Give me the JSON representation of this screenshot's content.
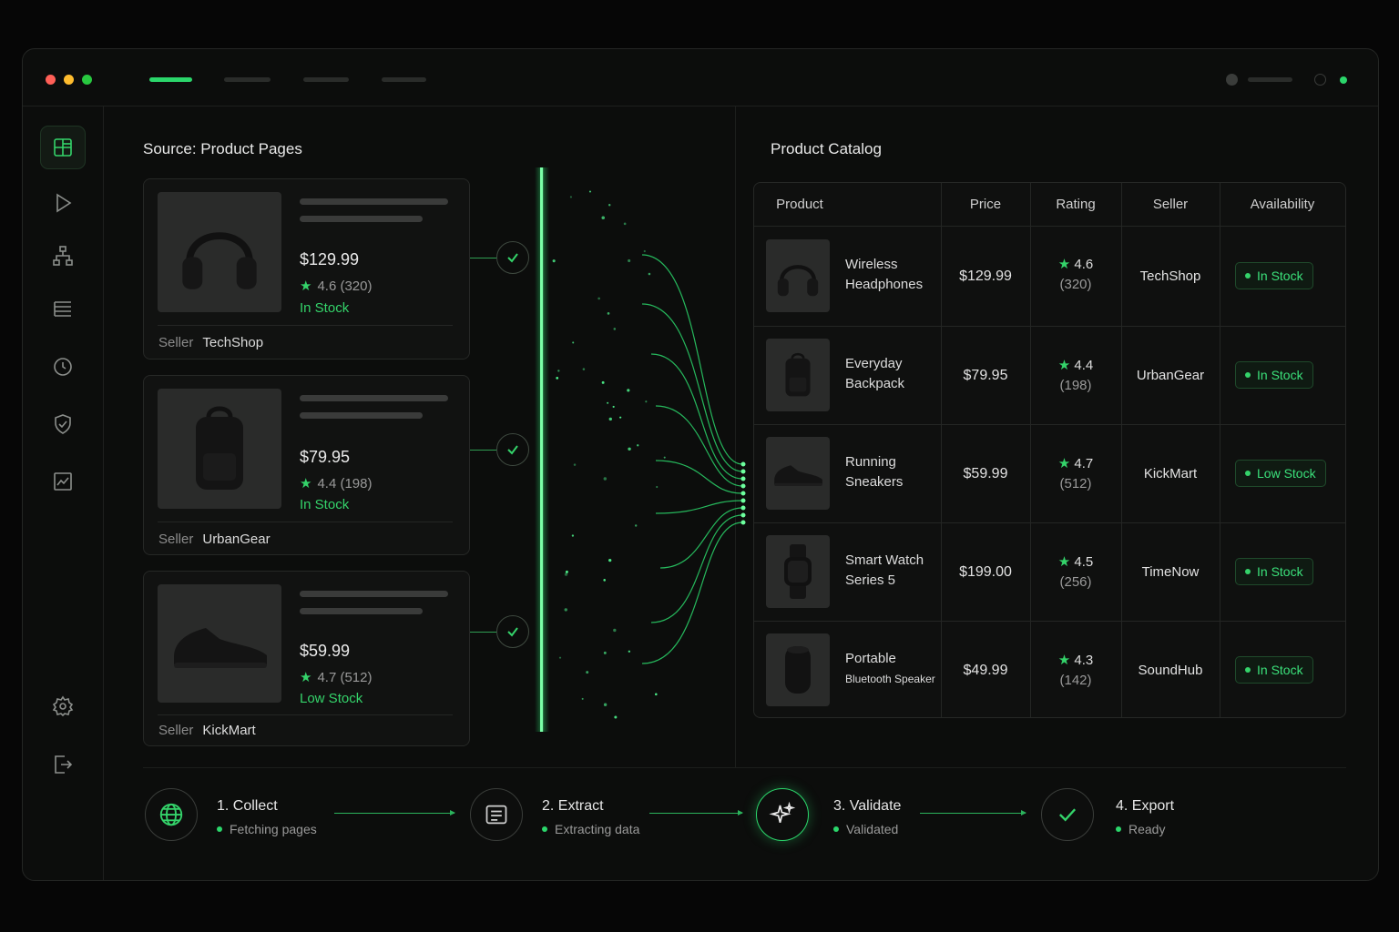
{
  "window": {
    "controls": {
      "close_color": "#ff5f57",
      "minimize_color": "#febc2e",
      "maximize_color": "#28c840"
    },
    "accent": "#2bd66b"
  },
  "sidebar": {
    "items": [
      {
        "icon": "dashboard-icon",
        "active": true
      },
      {
        "icon": "play-icon"
      },
      {
        "icon": "hierarchy-icon"
      },
      {
        "icon": "list-icon"
      },
      {
        "icon": "clock-icon"
      },
      {
        "icon": "shield-check-icon"
      },
      {
        "icon": "chart-icon"
      },
      {
        "icon": "gear-icon"
      },
      {
        "icon": "logout-icon"
      }
    ]
  },
  "source": {
    "title": "Source: Product Pages",
    "seller_label": "Seller",
    "cards": [
      {
        "price": "$129.99",
        "rating": "4.6 (320)",
        "stock": "In Stock",
        "seller": "TechShop",
        "image": "headphones-icon"
      },
      {
        "price": "$79.95",
        "rating": "4.4 (198)",
        "stock": "In Stock",
        "seller": "UrbanGear",
        "image": "backpack-icon"
      },
      {
        "price": "$59.99",
        "rating": "4.7 (512)",
        "stock": "Low Stock",
        "seller": "KickMart",
        "image": "sneaker-icon"
      }
    ]
  },
  "catalog": {
    "title": "Product Catalog",
    "columns": [
      "Product",
      "Price",
      "Rating",
      "Seller",
      "Availability"
    ],
    "rows": [
      {
        "name_line1": "Wireless",
        "name_line2": "Headphones",
        "price": "$129.99",
        "rating": "4.6",
        "count": "(320)",
        "seller": "TechShop",
        "availability": "In Stock",
        "image": "headphones-icon"
      },
      {
        "name_line1": "Everyday",
        "name_line2": "Backpack",
        "price": "$79.95",
        "rating": "4.4",
        "count": "(198)",
        "seller": "UrbanGear",
        "availability": "In Stock",
        "image": "backpack-icon"
      },
      {
        "name_line1": "Running",
        "name_line2": "Sneakers",
        "price": "$59.99",
        "rating": "4.7",
        "count": "(512)",
        "seller": "KickMart",
        "availability": "Low Stock",
        "image": "sneaker-icon"
      },
      {
        "name_line1": "Smart Watch",
        "name_line2": "Series 5",
        "price": "$199.00",
        "rating": "4.5",
        "count": "(256)",
        "seller": "TimeNow",
        "availability": "In Stock",
        "image": "smartwatch-icon"
      },
      {
        "name_line1": "Portable",
        "name_line2": "Bluetooth Speaker",
        "price": "$49.99",
        "rating": "4.3",
        "count": "(142)",
        "seller": "SoundHub",
        "availability": "In Stock",
        "image": "speaker-icon"
      }
    ]
  },
  "pipeline": {
    "steps": [
      {
        "title": "1. Collect",
        "status": "Fetching pages",
        "icon": "globe-icon"
      },
      {
        "title": "2. Extract",
        "status": "Extracting data",
        "icon": "document-icon"
      },
      {
        "title": "3. Validate",
        "status": "Validated",
        "icon": "sparkle-icon",
        "active": true
      },
      {
        "title": "4. Export",
        "status": "Ready",
        "icon": "check-icon"
      }
    ]
  }
}
